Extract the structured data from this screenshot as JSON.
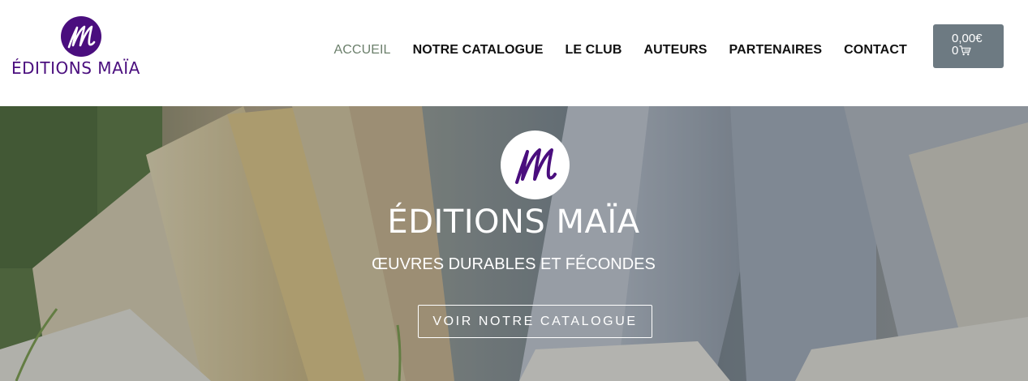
{
  "brand": {
    "name": "ÉDITIONS  MAÏA",
    "monogram": "m",
    "color": "#4a0e7e"
  },
  "nav": {
    "items": [
      {
        "label": "ACCUEIL",
        "active": true
      },
      {
        "label": "NOTRE CATALOGUE",
        "active": false
      },
      {
        "label": "LE CLUB",
        "active": false
      },
      {
        "label": "AUTEURS",
        "active": false
      },
      {
        "label": "PARTENAIRES",
        "active": false
      },
      {
        "label": "CONTACT",
        "active": false
      }
    ],
    "active_color": "#6b7f6b"
  },
  "cart": {
    "total": "0,00€",
    "count": "0",
    "icon": "cart-icon",
    "background": "#6d7a82"
  },
  "hero": {
    "title": "ÉDITIONS  MAÏA",
    "tagline": "ŒUVRES DURABLES ET FÉCONDES",
    "cta_label": "VOIR NOTRE CATALOGUE",
    "background_image": "open-book-pages-in-grass"
  }
}
